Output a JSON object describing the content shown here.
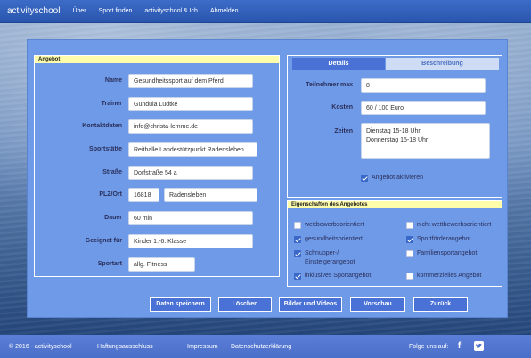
{
  "navbar": {
    "brand": "activityschool",
    "items": [
      "Über",
      "Sport finden",
      "activityschool & Ich",
      "Abmelden"
    ]
  },
  "left_panel": {
    "title": "Angebot",
    "fields": {
      "name": {
        "label": "Name",
        "value": "Gesundheitssport auf dem Pferd"
      },
      "trainer": {
        "label": "Trainer",
        "value": "Gundula Lüdtke"
      },
      "kontakt": {
        "label": "Kontaktdaten",
        "value": "info@christa-lemme.de"
      },
      "sportstaette": {
        "label": "Sportstätte",
        "value": "Reithalle Landestützpunkt Radensleben"
      },
      "strasse": {
        "label": "Straße",
        "value": "Dorfstraße 54 a"
      },
      "plzort": {
        "label": "PLZ/Ort",
        "plz": "16818",
        "ort": "Radensleben"
      },
      "dauer": {
        "label": "Dauer",
        "value": "60 min"
      },
      "geeignet": {
        "label": "Geeignet für",
        "value": "Kinder 1.-6. Klasse"
      },
      "sportart": {
        "label": "Sportart",
        "value": "allg. Fitness"
      }
    }
  },
  "right_panel": {
    "tabs": {
      "details": "Details",
      "beschreibung": "Beschreibung"
    },
    "teilnehmer": {
      "label": "Teilnehmer max",
      "value": "8"
    },
    "kosten": {
      "label": "Kosten",
      "value": "60 / 100 Euro"
    },
    "zeiten": {
      "label": "Zeiten",
      "line1": "Dienstag 15-18 Uhr",
      "line2": "Donnerstag 15-18 Uhr"
    },
    "aktivieren": {
      "label": "Angebot aktivieren",
      "checked": true
    }
  },
  "properties": {
    "title": "Eigenschaften des Angebotes",
    "items": [
      {
        "label": "wettbewerbsorientiert",
        "checked": false
      },
      {
        "label": "nicht wettbewerbsorientiert",
        "checked": false
      },
      {
        "label": "gesundheitsorientiert",
        "checked": true
      },
      {
        "label": "Sportförderangebot",
        "checked": true
      },
      {
        "label": "Schnupper-/",
        "label2": "Einsteigerangebot",
        "checked": true
      },
      {
        "label": "Familiensportangebot",
        "checked": false
      },
      {
        "label": "inklusives Sportangebot",
        "checked": true
      },
      {
        "label": "kommerzielles Angebot",
        "checked": false
      }
    ]
  },
  "buttons": {
    "save": "Daten speichern",
    "delete": "Löschen",
    "media": "Bilder und Videos",
    "preview": "Vorschau",
    "back": "Zurück"
  },
  "footer": {
    "copyright": "© 2016 - activityschool",
    "links": [
      "Haftungsausschluss",
      "Impressum",
      "Datenschutzerklärung"
    ],
    "follow": "Folge uns auf:",
    "icons": {
      "facebook": "facebook-icon",
      "twitter": "twitter-icon"
    }
  },
  "colors": {
    "nav": "#2a55ad",
    "panel": "#6e9ae8",
    "header_yellow": "#fffcaa",
    "button": "#4a72d6",
    "footer": "#4b6fc8"
  }
}
